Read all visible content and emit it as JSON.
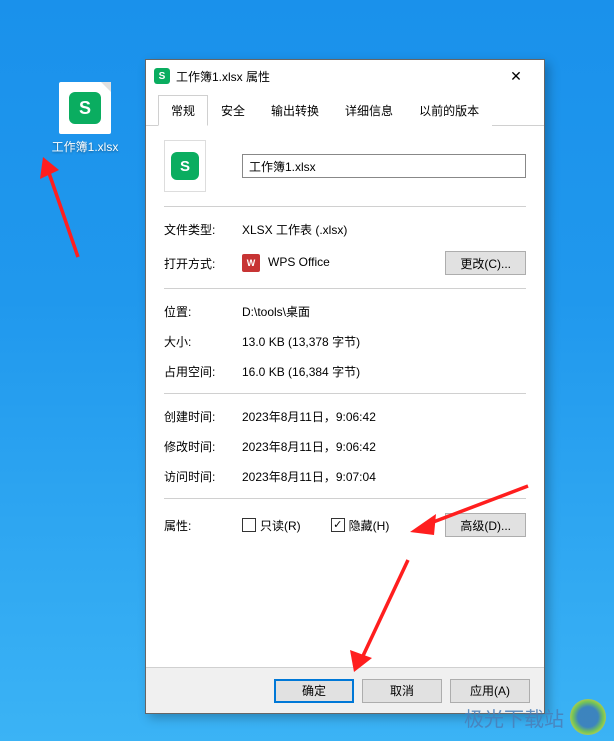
{
  "desktop": {
    "icon_label": "工作簿1.xlsx",
    "icon_badge": "S"
  },
  "dialog": {
    "title_icon": "S",
    "title": "工作簿1.xlsx 属性",
    "close": "✕",
    "tabs": [
      "常规",
      "安全",
      "输出转换",
      "详细信息",
      "以前的版本"
    ],
    "file_name": "工作簿1.xlsx",
    "file_icon_badge": "S",
    "rows": {
      "type_label": "文件类型:",
      "type_value": "XLSX 工作表 (.xlsx)",
      "open_label": "打开方式:",
      "open_app_icon": "W",
      "open_app": "WPS Office",
      "change_btn": "更改(C)...",
      "location_label": "位置:",
      "location_value": "D:\\tools\\桌面",
      "size_label": "大小:",
      "size_value": "13.0 KB (13,378 字节)",
      "disk_label": "占用空间:",
      "disk_value": "16.0 KB (16,384 字节)",
      "created_label": "创建时间:",
      "created_value": "2023年8月11日，9:06:42",
      "modified_label": "修改时间:",
      "modified_value": "2023年8月11日，9:06:42",
      "accessed_label": "访问时间:",
      "accessed_value": "2023年8月11日，9:07:04"
    },
    "attr": {
      "label": "属性:",
      "readonly": "只读(R)",
      "hidden": "隐藏(H)",
      "advanced": "高级(D)..."
    },
    "buttons": {
      "ok": "确定",
      "cancel": "取消",
      "apply": "应用(A)"
    }
  },
  "watermark": "极光下载站"
}
